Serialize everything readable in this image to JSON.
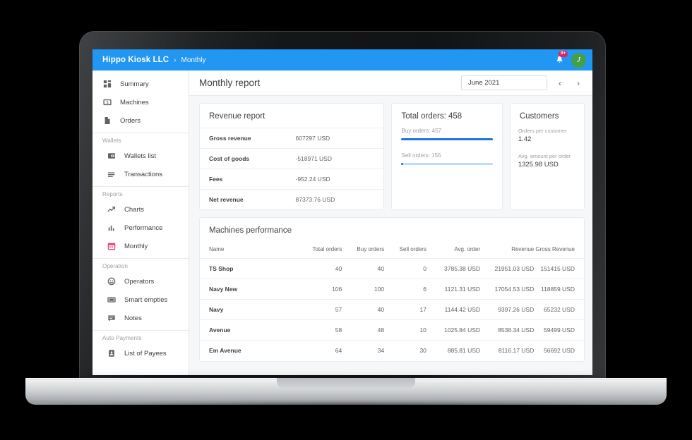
{
  "topbar": {
    "brand": "Hippo Kiosk LLC",
    "separator": "›",
    "breadcrumb": "Monthly",
    "notification_badge": "9+",
    "avatar_initial": "J"
  },
  "sidebar": {
    "items": [
      {
        "label": "Summary",
        "icon": "dashboard-icon"
      },
      {
        "label": "Machines",
        "icon": "money-box-icon"
      },
      {
        "label": "Orders",
        "icon": "document-icon"
      }
    ],
    "groups": [
      {
        "title": "Wallets",
        "items": [
          {
            "label": "Wallets list",
            "icon": "wallet-icon"
          },
          {
            "label": "Transactions",
            "icon": "list-icon"
          }
        ]
      },
      {
        "title": "Reports",
        "items": [
          {
            "label": "Charts",
            "icon": "trend-line-icon"
          },
          {
            "label": "Performance",
            "icon": "bar-chart-icon"
          },
          {
            "label": "Monthly",
            "icon": "calendar-icon",
            "active": true
          }
        ]
      },
      {
        "title": "Operation",
        "items": [
          {
            "label": "Operators",
            "icon": "operator-face-icon"
          },
          {
            "label": "Smart empties",
            "icon": "cash-note-icon"
          },
          {
            "label": "Notes",
            "icon": "comment-icon"
          }
        ]
      },
      {
        "title": "Auto Payments",
        "items": [
          {
            "label": "List of Payees",
            "icon": "contact-card-icon"
          }
        ]
      }
    ]
  },
  "header": {
    "title": "Monthly report",
    "date_value": "June 2021",
    "prev_label": "‹",
    "next_label": "›"
  },
  "revenue_report": {
    "title": "Revenue report",
    "rows": [
      {
        "key": "Gross revenue",
        "value": "607297 USD"
      },
      {
        "key": "Cost of goods",
        "value": "-518971 USD"
      },
      {
        "key": "Fees",
        "value": "-952.24 USD"
      },
      {
        "key": "Net revenue",
        "value": "87373.76 USD"
      }
    ]
  },
  "total_orders": {
    "title": "Total orders: 458",
    "buy_label": "Buy orders: 457",
    "buy_percent": 100,
    "sell_label": "Sell orders: 155",
    "sell_percent": 2,
    "bar_color": "#1a73e8",
    "track_color": "#bddcfb"
  },
  "customers": {
    "title": "Customers",
    "metric1_label": "Orders per customer",
    "metric1_value": "1.42",
    "metric2_label": "Avg. amount per order",
    "metric2_value": "1325.98 USD"
  },
  "machines_performance": {
    "title": "Machines performance",
    "columns": [
      "Name",
      "Total orders",
      "Buy orders",
      "Sell orders",
      "Avg. order",
      "Revenue",
      "Gross Revenue"
    ],
    "rows": [
      [
        "TS Shop",
        "40",
        "40",
        "0",
        "3785.38 USD",
        "21951.03 USD",
        "151415 USD"
      ],
      [
        "Navy New",
        "106",
        "100",
        "6",
        "1121.31 USD",
        "17054.53 USD",
        "118859 USD"
      ],
      [
        "Navy",
        "57",
        "40",
        "17",
        "1144.42 USD",
        "9397.26 USD",
        "65232 USD"
      ],
      [
        "Avenue",
        "58",
        "48",
        "10",
        "1025.84 USD",
        "8538.34 USD",
        "59499 USD"
      ],
      [
        "Em Avenue",
        "64",
        "34",
        "30",
        "885.81 USD",
        "8116.17 USD",
        "56692 USD"
      ]
    ]
  },
  "colors": {
    "topbar": "#2196f3",
    "accent": "#1a73e8",
    "badge": "#e91e63",
    "avatar": "#43a047",
    "active_icon": "#ec407a"
  }
}
